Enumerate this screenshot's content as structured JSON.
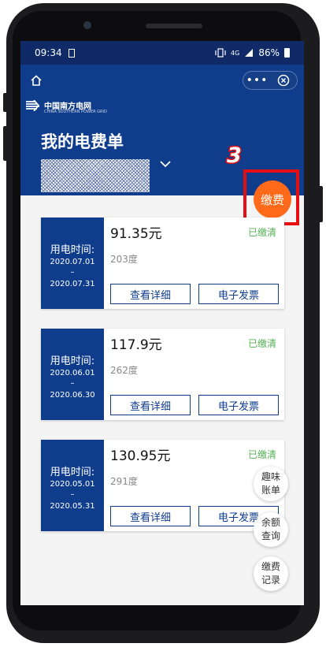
{
  "status_bar": {
    "time": "09:34",
    "network": "4G",
    "battery": "86%"
  },
  "header": {
    "logo_text": "中国南方电网",
    "logo_subtext": "CHINA SOUTHERN POWER GRID",
    "title": "我的电费单",
    "more_label": "•••"
  },
  "pay_button": {
    "label": "缴费"
  },
  "annotation": {
    "step": "3",
    "color": "#e50f13"
  },
  "bills": [
    {
      "period_label": "用电时间:",
      "start": "2020.07.01",
      "dash": "–",
      "end": "2020.07.31",
      "amount": "91.35元",
      "status": "已缴清",
      "usage": "203度",
      "detail_label": "查看详细",
      "invoice_label": "电子发票"
    },
    {
      "period_label": "用电时间:",
      "start": "2020.06.01",
      "dash": "–",
      "end": "2020.06.30",
      "amount": "117.9元",
      "status": "已缴清",
      "usage": "262度",
      "detail_label": "查看详细",
      "invoice_label": "电子发票"
    },
    {
      "period_label": "用电时间:",
      "start": "2020.05.01",
      "dash": "–",
      "end": "2020.05.31",
      "amount": "130.95元",
      "status": "已缴清",
      "usage": "291度",
      "detail_label": "查看详细",
      "invoice_label": "电子发票"
    }
  ],
  "floating_buttons": [
    {
      "line1": "趣味",
      "line2": "账单"
    },
    {
      "line1": "余额",
      "line2": "查询"
    },
    {
      "line1": "缴费",
      "line2": "记录"
    }
  ],
  "colors": {
    "brand_blue": "#0f3d8c",
    "pay_orange": "#ff6a1a",
    "paid_green": "#56b056"
  }
}
